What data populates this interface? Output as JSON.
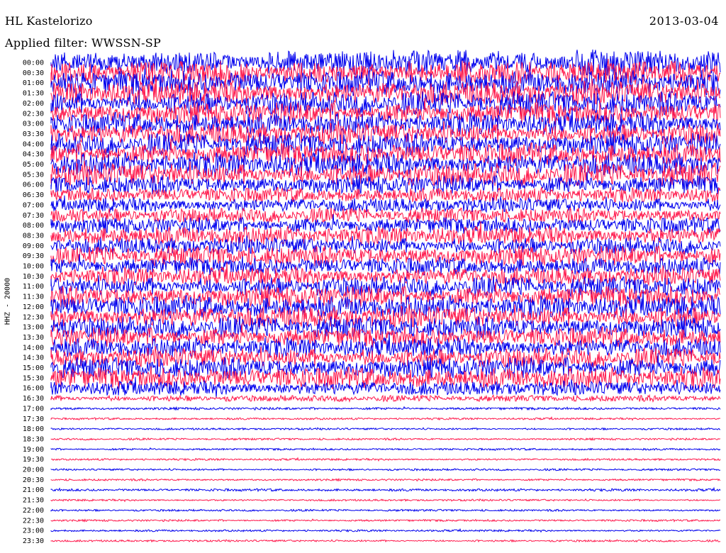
{
  "header": {
    "station": "HL Kastelorizo",
    "date": "2013-03-04",
    "filter": "Applied filter: WWSSN-SP",
    "channel_label": "HHZ - 20000"
  },
  "colors": {
    "series_a": "#0000ee",
    "series_b": "#ff1a4d",
    "text": "#000000"
  },
  "chart_data": {
    "type": "line",
    "title": "HL Kastelorizo",
    "rows": [
      {
        "time": "00:00",
        "amp": 1.0
      },
      {
        "time": "00:30",
        "amp": 1.0
      },
      {
        "time": "01:00",
        "amp": 1.0
      },
      {
        "time": "01:30",
        "amp": 1.0
      },
      {
        "time": "02:00",
        "amp": 0.95
      },
      {
        "time": "02:30",
        "amp": 0.9
      },
      {
        "time": "03:00",
        "amp": 0.9
      },
      {
        "time": "03:30",
        "amp": 0.9
      },
      {
        "time": "04:00",
        "amp": 0.9
      },
      {
        "time": "04:30",
        "amp": 0.9
      },
      {
        "time": "05:00",
        "amp": 0.95
      },
      {
        "time": "05:30",
        "amp": 0.95
      },
      {
        "time": "06:00",
        "amp": 0.75
      },
      {
        "time": "06:30",
        "amp": 0.6
      },
      {
        "time": "07:00",
        "amp": 0.6
      },
      {
        "time": "07:30",
        "amp": 0.6
      },
      {
        "time": "08:00",
        "amp": 0.65
      },
      {
        "time": "08:30",
        "amp": 0.75
      },
      {
        "time": "09:00",
        "amp": 0.7
      },
      {
        "time": "09:30",
        "amp": 0.8
      },
      {
        "time": "10:00",
        "amp": 0.7
      },
      {
        "time": "10:30",
        "amp": 0.75
      },
      {
        "time": "11:00",
        "amp": 0.8
      },
      {
        "time": "11:30",
        "amp": 0.85
      },
      {
        "time": "12:00",
        "amp": 0.9
      },
      {
        "time": "12:30",
        "amp": 0.9
      },
      {
        "time": "13:00",
        "amp": 0.85
      },
      {
        "time": "13:30",
        "amp": 0.8
      },
      {
        "time": "14:00",
        "amp": 0.8
      },
      {
        "time": "14:30",
        "amp": 0.8
      },
      {
        "time": "15:00",
        "amp": 0.85
      },
      {
        "time": "15:30",
        "amp": 0.85
      },
      {
        "time": "16:00",
        "amp": 0.6
      },
      {
        "time": "16:30",
        "amp": 0.25
      },
      {
        "time": "17:00",
        "amp": 0.1
      },
      {
        "time": "17:30",
        "amp": 0.08
      },
      {
        "time": "18:00",
        "amp": 0.08
      },
      {
        "time": "18:30",
        "amp": 0.08
      },
      {
        "time": "19:00",
        "amp": 0.08
      },
      {
        "time": "19:30",
        "amp": 0.08
      },
      {
        "time": "20:00",
        "amp": 0.08
      },
      {
        "time": "20:30",
        "amp": 0.08
      },
      {
        "time": "21:00",
        "amp": 0.1
      },
      {
        "time": "21:30",
        "amp": 0.08
      },
      {
        "time": "22:00",
        "amp": 0.08
      },
      {
        "time": "22:30",
        "amp": 0.08
      },
      {
        "time": "23:00",
        "amp": 0.08
      },
      {
        "time": "23:30",
        "amp": 0.08
      }
    ]
  }
}
